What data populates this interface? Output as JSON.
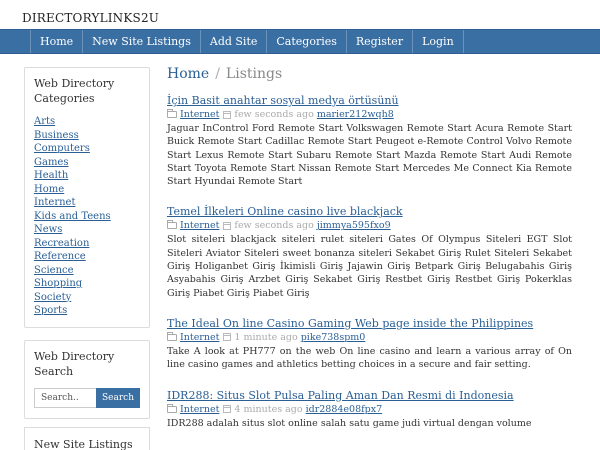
{
  "site": {
    "title": "DIRECTORYLINKS2U"
  },
  "nav": {
    "items": [
      "Home",
      "New Site Listings",
      "Add Site",
      "Categories",
      "Register",
      "Login"
    ]
  },
  "sidebar": {
    "categories_title": "Web Directory Categories",
    "categories": [
      "Arts",
      "Business",
      "Computers",
      "Games",
      "Health",
      "Home",
      "Internet",
      "Kids and Teens",
      "News",
      "Recreation",
      "Reference",
      "Science",
      "Shopping",
      "Society",
      "Sports"
    ],
    "search_title": "Web Directory Search",
    "search_placeholder": "Search..",
    "search_button": "Search",
    "new_listings_title": "New Site Listings"
  },
  "breadcrumb": {
    "home": "Home",
    "separator": "/",
    "current": "Listings"
  },
  "listings": [
    {
      "title": "İçin Basit anahtar sosyal medya örtüsünü",
      "category": "Internet",
      "time": "few seconds ago",
      "user": "marier212wqh8",
      "description": "Jaguar InControl Ford Remote Start Volkswagen Remote Start Acura Remote Start Buick Remote Start Cadillac Remote Start Peugeot e-Remote Control Volvo Remote Start Lexus Remote Start Subaru Remote Start Mazda Remote Start Audi Remote Start Toyota Remote Start Nissan Remote Start Mercedes Me Connect Kia Remote Start Hyundai Remote Start"
    },
    {
      "title": "Temel İlkeleri Online casino live blackjack",
      "category": "Internet",
      "time": "few seconds ago",
      "user": "jimmya595fxo9",
      "description": "Slot siteleri blackjack siteleri rulet siteleri Gates Of Olympus Siteleri EGT Slot Siteleri Aviator Siteleri sweet bonanza siteleri Sekabet Giriş Rulet Siteleri Sekabet Giriş Holiganbet Giriş İkimisli Giriş Jajawin Giriş Betpark Giriş Belugabahis Giriş Asyabahis Giriş Arzbet Giriş Sekabet Giriş Restbet Giriş Restbet Giriş Pokerklas Giriş Piabet Giriş Piabet Giriş"
    },
    {
      "title": "The Ideal On line Casino Gaming Web page inside the Philippines",
      "category": "Internet",
      "time": "1 minute ago",
      "user": "pike738spm0",
      "description": "Take A look at PH777 on the web On line casino and learn a various array of On line casino games and athletics betting choices in a secure and fair setting."
    },
    {
      "title": "IDR288: Situs Slot Pulsa Paling Aman Dan Resmi di Indonesia",
      "category": "Internet",
      "time": "4 minutes ago",
      "user": "idr2884e08fpx7",
      "description": "IDR288 adalah situs slot online salah satu game judi virtual dengan volume"
    }
  ]
}
